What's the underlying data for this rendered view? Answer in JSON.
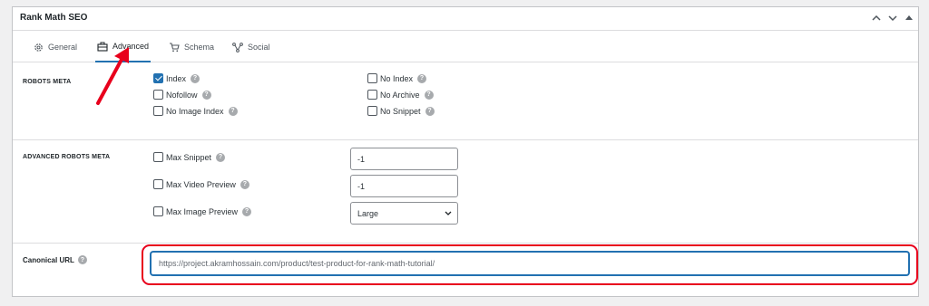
{
  "panel": {
    "title": "Rank Math SEO"
  },
  "header_controls": [
    {
      "name": "collapse-up-icon",
      "glyph": "︿"
    },
    {
      "name": "collapse-down-icon",
      "glyph": "﹀"
    },
    {
      "name": "toggle-panel-icon",
      "glyph": "▲"
    }
  ],
  "tabs": [
    {
      "label": "General",
      "icon": "gear-icon",
      "active": false
    },
    {
      "label": "Advanced",
      "icon": "toolbox-icon",
      "active": true
    },
    {
      "label": "Schema",
      "icon": "cart-icon",
      "active": false
    },
    {
      "label": "Social",
      "icon": "share-icon",
      "active": false
    }
  ],
  "robots_meta": {
    "label": "ROBOTS META",
    "left": [
      {
        "label": "Index",
        "checked": true
      },
      {
        "label": "Nofollow",
        "checked": false
      },
      {
        "label": "No Image Index",
        "checked": false
      }
    ],
    "right": [
      {
        "label": "No Index",
        "checked": false
      },
      {
        "label": "No Archive",
        "checked": false
      },
      {
        "label": "No Snippet",
        "checked": false
      }
    ]
  },
  "advanced_robots_meta": {
    "label": "ADVANCED ROBOTS META",
    "rows": [
      {
        "label": "Max Snippet",
        "checked": false,
        "value": "-1"
      },
      {
        "label": "Max Video Preview",
        "checked": false,
        "value": "-1"
      },
      {
        "label": "Max Image Preview",
        "checked": false,
        "value": "Large"
      }
    ]
  },
  "canonical": {
    "label": "Canonical URL",
    "placeholder": "https://project.akramhossain.com/product/test-product-for-rank-math-tutorial/"
  },
  "colors": {
    "accent": "#2271b1",
    "highlight": "#e8001c",
    "arrow": "#e8001c"
  }
}
